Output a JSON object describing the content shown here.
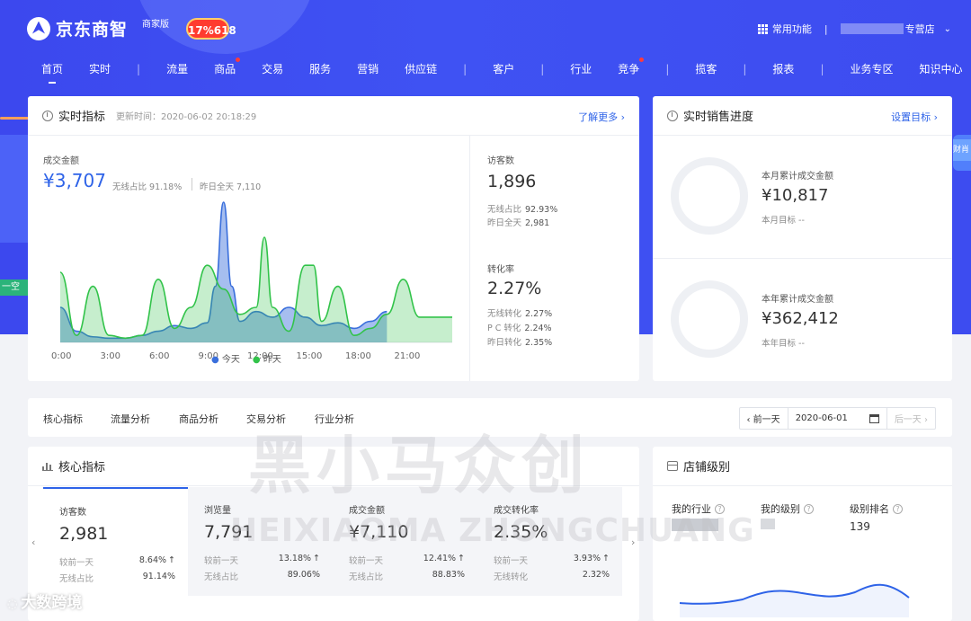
{
  "header": {
    "logo_text": "京东商智",
    "merchant_tag": "商家版",
    "promo_badge": "17%618",
    "common_functions": "常用功能",
    "divider": "|",
    "shop_suffix": "专营店",
    "chevron": "⌄"
  },
  "nav": [
    {
      "label": "首页",
      "active": true,
      "dot": false
    },
    {
      "label": "实时",
      "active": false,
      "dot": false
    },
    {
      "label": "流量",
      "active": false,
      "dot": false
    },
    {
      "label": "商品",
      "active": false,
      "dot": true
    },
    {
      "label": "交易",
      "active": false,
      "dot": false
    },
    {
      "label": "服务",
      "active": false,
      "dot": false
    },
    {
      "label": "营销",
      "active": false,
      "dot": false
    },
    {
      "label": "供应链",
      "active": false,
      "dot": false
    },
    {
      "label": "客户",
      "active": false,
      "dot": false
    },
    {
      "label": "行业",
      "active": false,
      "dot": false
    },
    {
      "label": "竞争",
      "active": false,
      "dot": true
    },
    {
      "label": "揽客",
      "active": false,
      "dot": false
    },
    {
      "label": "报表",
      "active": false,
      "dot": false
    },
    {
      "label": "业务专区",
      "active": false,
      "dot": false
    },
    {
      "label": "知识中心",
      "active": false,
      "dot": false
    }
  ],
  "side_tabs": {
    "left": "一空",
    "right": "财肖"
  },
  "realtime": {
    "title": "实时指标",
    "update_time": "更新时间：2020-06-02 20:18:29",
    "learn_more": "了解更多 ›",
    "gmv_label": "成交金额",
    "gmv_value": "¥3,707",
    "wireless_share": "无线占比 91.18%",
    "yesterday_total": "昨日全天 7,110",
    "visitors_label": "访客数",
    "visitors_value": "1,896",
    "visitors_wireless_label": "无线占比",
    "visitors_wireless_value": "92.93%",
    "visitors_yday_label": "昨日全天",
    "visitors_yday_value": "2,981",
    "conv_label": "转化率",
    "conv_value": "2.27%",
    "conv_wireless_label": "无线转化",
    "conv_wireless_value": "2.27%",
    "conv_pc_label": "P C 转化",
    "conv_pc_value": "2.24%",
    "conv_yday_label": "昨日转化",
    "conv_yday_value": "2.35%"
  },
  "chart_data": {
    "type": "area",
    "x_ticks": [
      "0:00",
      "3:00",
      "6:00",
      "9:00",
      "12:00",
      "15:00",
      "18:00",
      "21:00"
    ],
    "x_range": [
      0,
      24
    ],
    "y_range": [
      0,
      100
    ],
    "legend": [
      "今天",
      "昨天"
    ],
    "legend_placement": "bottom",
    "series": [
      {
        "name": "今天",
        "color": "#3a6fdc",
        "x": [
          0,
          1,
          2,
          3,
          4,
          5,
          6,
          7,
          8,
          9,
          9.5,
          10,
          10.5,
          11,
          12,
          13,
          14,
          15,
          16,
          17,
          18,
          19,
          20
        ],
        "y": [
          25,
          8,
          4,
          3,
          3,
          5,
          8,
          12,
          10,
          14,
          40,
          100,
          40,
          15,
          22,
          18,
          25,
          18,
          12,
          14,
          10,
          15,
          22
        ]
      },
      {
        "name": "昨天",
        "color": "#32c34a",
        "x": [
          0,
          1,
          2,
          3,
          4,
          5,
          6,
          7,
          8,
          9,
          10,
          11,
          12,
          12.5,
          13,
          14,
          15,
          15.5,
          16,
          17,
          18,
          19,
          20,
          21,
          22,
          23,
          24
        ],
        "y": [
          50,
          5,
          40,
          5,
          3,
          5,
          45,
          10,
          25,
          55,
          38,
          20,
          25,
          75,
          25,
          8,
          55,
          55,
          15,
          40,
          5,
          10,
          20,
          45,
          18,
          18,
          18
        ]
      }
    ]
  },
  "sales_progress": {
    "title": "实时销售进度",
    "set_goal": "设置目标 ›",
    "month_label": "本月累计成交金额",
    "month_value": "¥10,817",
    "month_target": "本月目标 --",
    "year_label": "本年累计成交金额",
    "year_value": "¥362,412",
    "year_target": "本年目标 --"
  },
  "analysis_tabs": [
    "核心指标",
    "流量分析",
    "商品分析",
    "交易分析",
    "行业分析"
  ],
  "date_picker": {
    "prev": "‹ 前一天",
    "date": "2020-06-01",
    "next": "后一天 ›"
  },
  "core": {
    "title": "核心指标",
    "prev_arrow": "‹",
    "next_arrow": "›",
    "metrics": [
      {
        "label": "访客数",
        "value": "2,981",
        "r1_label": "较前一天",
        "r1_value": "8.64%",
        "r2_label": "无线占比",
        "r2_value": "91.14%",
        "active": true
      },
      {
        "label": "浏览量",
        "value": "7,791",
        "r1_label": "较前一天",
        "r1_value": "13.18%",
        "r2_label": "无线占比",
        "r2_value": "89.06%",
        "active": false
      },
      {
        "label": "成交金额",
        "value": "¥7,110",
        "r1_label": "较前一天",
        "r1_value": "12.41%",
        "r2_label": "无线占比",
        "r2_value": "88.83%",
        "active": false
      },
      {
        "label": "成交转化率",
        "value": "2.35%",
        "r1_label": "较前一天",
        "r1_value": "3.93%",
        "r2_label": "无线转化",
        "r2_value": "2.32%",
        "active": false
      }
    ],
    "up_arrow": "↑"
  },
  "store_level": {
    "title": "店铺级别",
    "industry_label": "我的行业",
    "level_label": "我的级别",
    "rank_label": "级别排名",
    "rank_value": "139",
    "help": "?"
  },
  "watermark": {
    "line1": "黑小马众创",
    "line2": "HEIXIAOMA ZHONGCHUANG",
    "corner": "大数跨境"
  }
}
